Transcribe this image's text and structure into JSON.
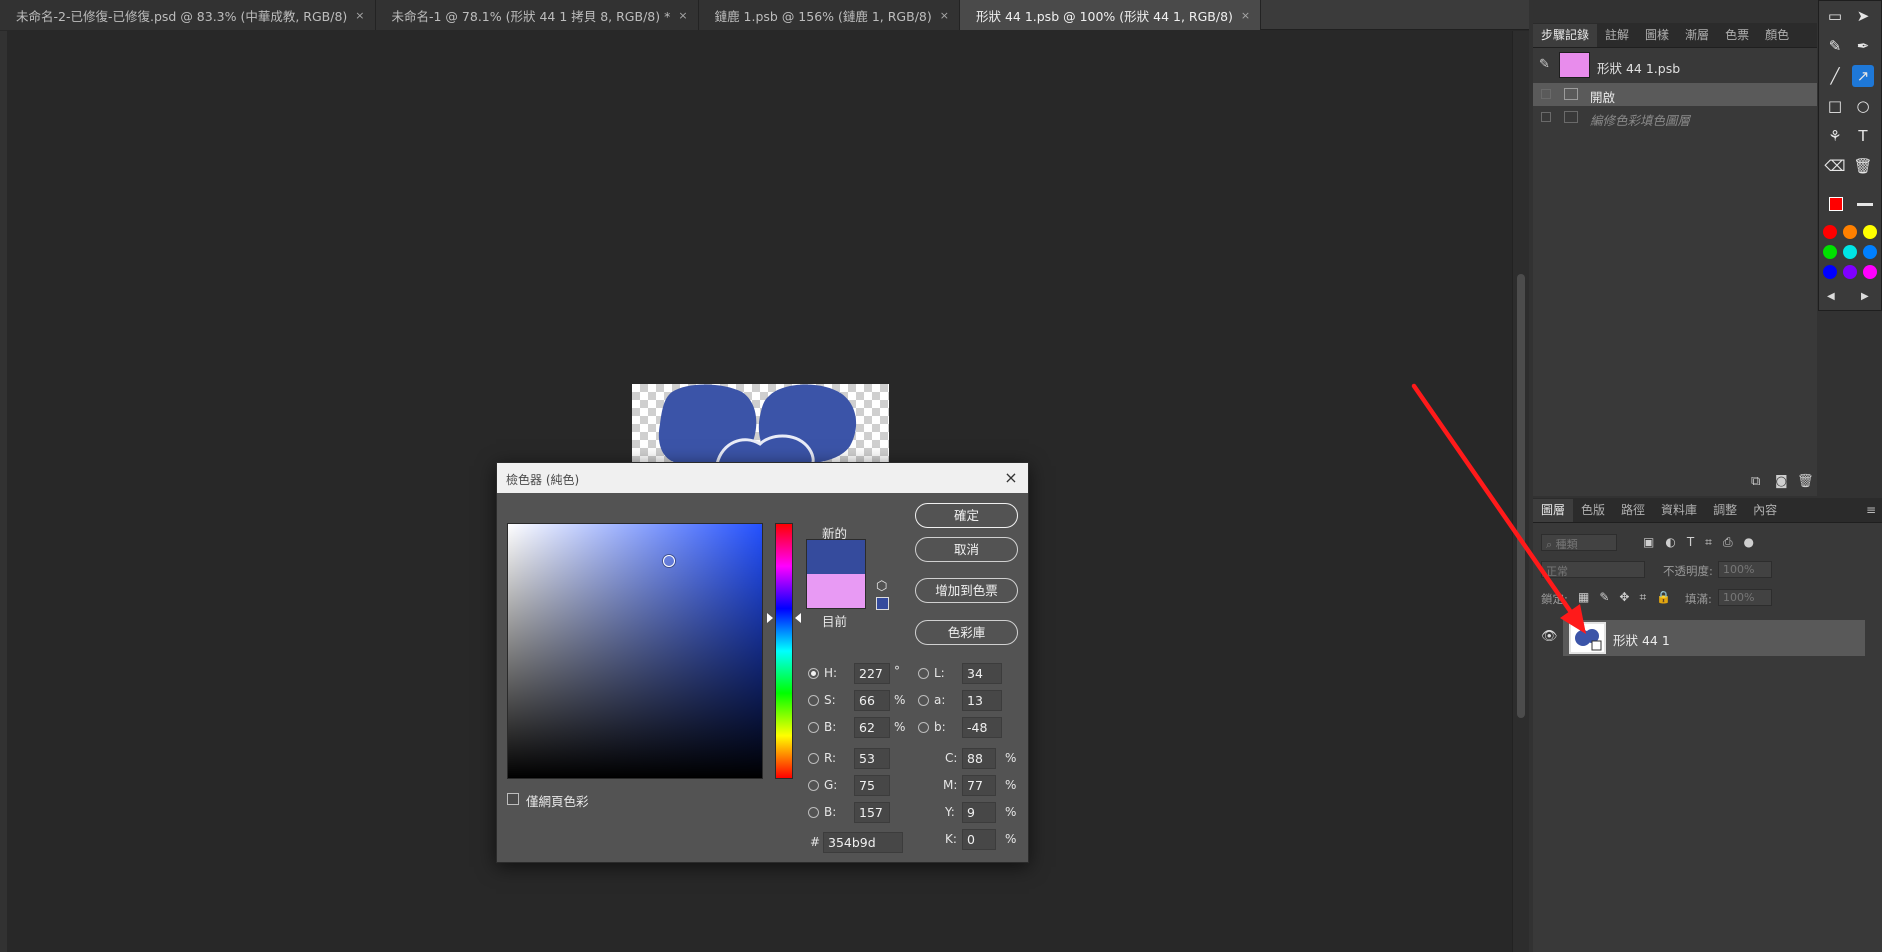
{
  "doc_tabs": [
    {
      "label": "未命名-2-已修復-已修復.psd @ 83.3% (中華成教, RGB/8)",
      "close": "×"
    },
    {
      "label": "未命名-1 @ 78.1% (形狀 44 1 拷貝 8, RGB/8) *",
      "close": "×"
    },
    {
      "label": "鏈鹿 1.psb @ 156% (鏈鹿 1, RGB/8)",
      "close": "×"
    },
    {
      "label": "形狀 44 1.psb @ 100% (形狀 44 1, RGB/8)",
      "close": "×"
    }
  ],
  "color_picker": {
    "title": "檢色器 (純色)",
    "close": "×",
    "new_label": "新的",
    "current_label": "目前",
    "new_color": "#354b9d",
    "current_color": "#e89af4",
    "buttons": {
      "ok": "確定",
      "cancel": "取消",
      "add_swatch": "增加到色票",
      "libraries": "色彩庫"
    },
    "hsb": {
      "H": "227",
      "S": "66",
      "B": "62"
    },
    "hsb_units": {
      "H": "°",
      "S": "%",
      "B": "%"
    },
    "lab": {
      "L": "34",
      "a": "13",
      "b": "-48"
    },
    "rgb": {
      "R": "53",
      "G": "75",
      "B": "157"
    },
    "cmyk": {
      "C": "88",
      "M": "77",
      "Y": "9",
      "K": "0"
    },
    "cmyk_unit": "%",
    "hex_label": "#",
    "hex": "354b9d",
    "web_only_label": "僅網頁色彩",
    "field_labels": {
      "H": "H:",
      "S": "S:",
      "Bri": "B:",
      "L": "L:",
      "a": "a:",
      "b": "b:",
      "R": "R:",
      "G": "G:",
      "Blue": "B:",
      "C": "C:",
      "M": "M:",
      "Y": "Y:",
      "K": "K:"
    }
  },
  "history_panel": {
    "tabs": [
      "步驟記錄",
      "註解",
      "圖樣",
      "漸層",
      "色票",
      "顏色"
    ],
    "snapshot": "形狀 44 1.psb",
    "steps": [
      "開啟",
      "編修色彩填色圖層"
    ]
  },
  "layers_panel": {
    "tabs": [
      "圖層",
      "色版",
      "路徑",
      "資料庫",
      "調整",
      "內容"
    ],
    "filter_placeholder": "種類",
    "blend_mode": "正常",
    "opacity_label": "不透明度:",
    "opacity": "100%",
    "lock_label": "鎖定:",
    "fill_label": "填滿:",
    "fill": "100%",
    "layers": [
      {
        "name": "形狀 44 1"
      }
    ]
  },
  "tool_palette": {
    "colors": [
      "#ff0000",
      "#ff8000",
      "#ffff00",
      "#00e000",
      "#00e5e5",
      "#0080ff",
      "#0000ff",
      "#8000ff",
      "#ff00ff"
    ],
    "active_color": "#ff0000",
    "nav_prev": "◀",
    "nav_next": "▶"
  },
  "annotation": {
    "arrow_color": "#ff1a1a"
  }
}
